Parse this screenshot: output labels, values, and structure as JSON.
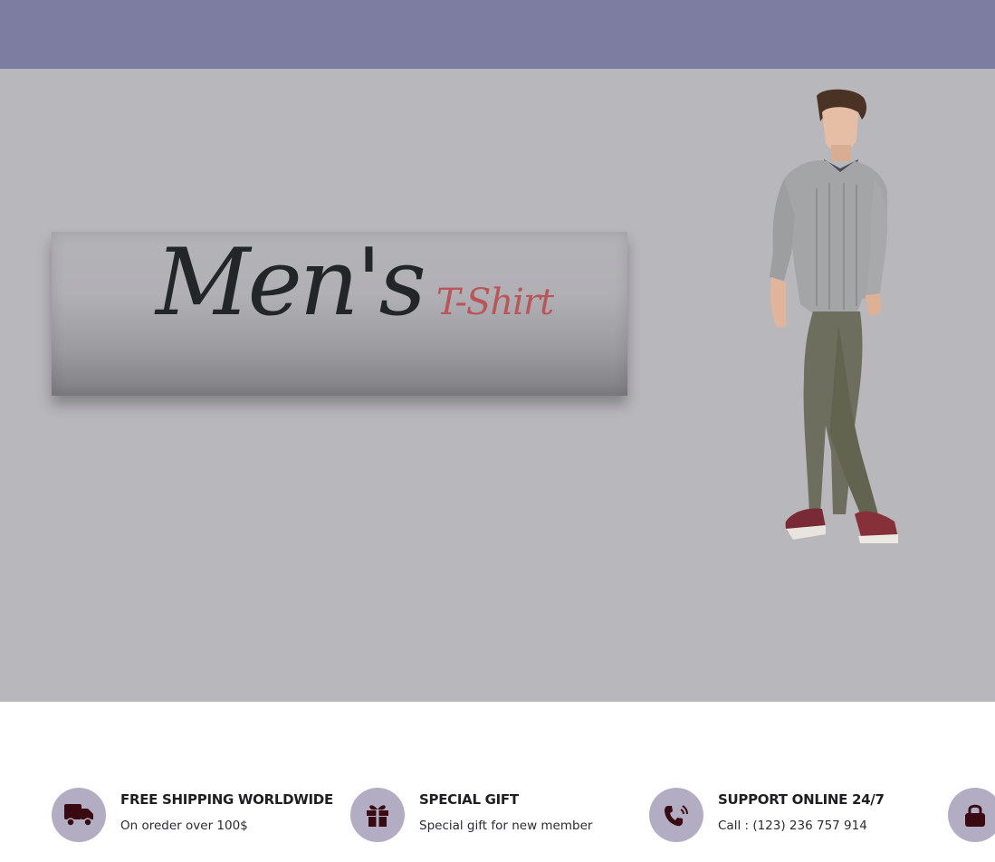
{
  "hero": {
    "title_main": "Men's",
    "title_sub": "T-Shirt",
    "colors": {
      "topbar": "#7c7da0",
      "background": "#b8b7bc",
      "title": "#232629",
      "subtitle": "#b9565a"
    }
  },
  "features": [
    {
      "icon": "truck-icon",
      "title": "FREE SHIPPING WORLDWIDE",
      "desc": "On oreder over 100$"
    },
    {
      "icon": "gift-icon",
      "title": "SPECIAL GIFT",
      "desc": "Special gift for new member"
    },
    {
      "icon": "phone-icon",
      "title": "SUPPORT ONLINE 24/7",
      "desc": "Call : (123) 236 757 914"
    },
    {
      "icon": "lock-icon",
      "title": "",
      "desc": ""
    }
  ],
  "feature_icon_bg": "#b3adc4",
  "feature_icon_color": "#3a0a12"
}
